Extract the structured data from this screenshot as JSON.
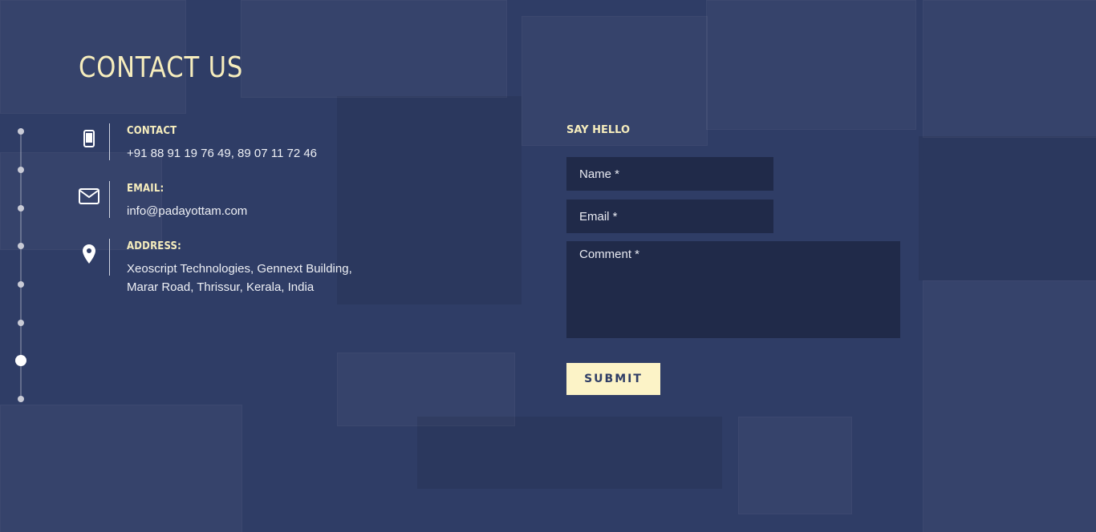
{
  "page": {
    "title": "CONTACT US"
  },
  "contact": [
    {
      "label": "CONTACT",
      "value": "+91 88 91 19 76 49, 89 07 11 72 46",
      "icon": "mobile-phone-icon"
    },
    {
      "label": "EMAIL:",
      "value": "info@padayottam.com",
      "icon": "envelope-icon"
    },
    {
      "label": "ADDRESS:",
      "value_line1": "Xeoscript Technologies, Gennext Building,",
      "value_line2": "Marar Road, Thrissur, Kerala, India",
      "icon": "map-pin-icon"
    }
  ],
  "form": {
    "heading": "SAY HELLO",
    "name_placeholder": "Name *",
    "email_placeholder": "Email *",
    "comment_placeholder": "Comment *",
    "submit_label": "SUBMIT"
  },
  "dot_nav": {
    "count": 8,
    "active_index": 6
  },
  "colors": {
    "background": "#2f3d66",
    "accent": "#f6edbd",
    "button": "#fcf3c7"
  }
}
